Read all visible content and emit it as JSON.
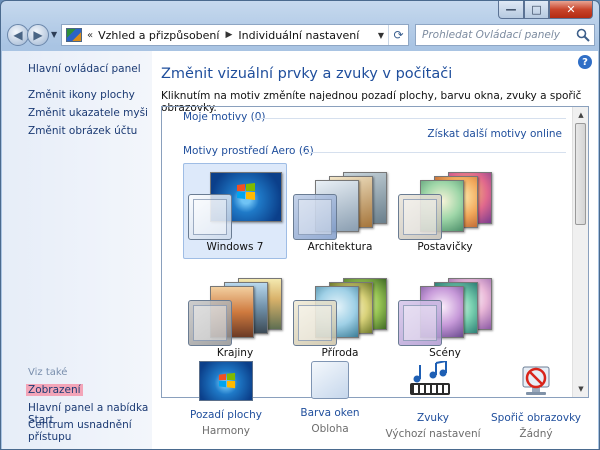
{
  "window": {
    "caption_buttons": {
      "minimize": "—",
      "maximize": "□",
      "close": "✕"
    }
  },
  "address_bar": {
    "root_chevron": "«",
    "crumbs": [
      "Vzhled a přizpůsobení",
      "Individuální nastavení"
    ],
    "search_placeholder": "Prohledat Ovládací panely"
  },
  "sidebar": {
    "home_link": "Hlavní ovládací panel",
    "tasks": [
      "Změnit ikony plochy",
      "Změnit ukazatele myši",
      "Změnit obrázek účtu"
    ],
    "see_also_heading": "Viz také",
    "see_also": [
      "Zobrazení",
      "Hlavní panel a nabídka Start",
      "Centrum usnadnění přístupu"
    ]
  },
  "main": {
    "help": "?",
    "title": "Změnit vizuální prvky a zvuky v počítači",
    "description": "Kliknutím na motiv změníte najednou pozadí plochy, barvu okna, zvuky a spořič obrazovky.",
    "my_themes_label": "Moje motivy (0)",
    "online_link": "Získat další motivy online",
    "aero_label": "Motivy prostředí Aero (6)",
    "themes": [
      {
        "label": "Windows 7",
        "selected": true
      },
      {
        "label": "Architektura",
        "selected": false
      },
      {
        "label": "Postavičky",
        "selected": false
      },
      {
        "label": "Krajiny",
        "selected": false
      },
      {
        "label": "Příroda",
        "selected": false
      },
      {
        "label": "Scény",
        "selected": false
      }
    ]
  },
  "options": [
    {
      "label": "Pozadí plochy",
      "value": "Harmony",
      "icon": "wallpaper-icon"
    },
    {
      "label": "Barva oken",
      "value": "Obloha",
      "icon": "window-color-icon"
    },
    {
      "label": "Zvuky",
      "value": "Výchozí nastavení",
      "icon": "sounds-icon"
    },
    {
      "label": "Spořič obrazovky",
      "value": "Žádný",
      "icon": "screensaver-icon"
    }
  ]
}
